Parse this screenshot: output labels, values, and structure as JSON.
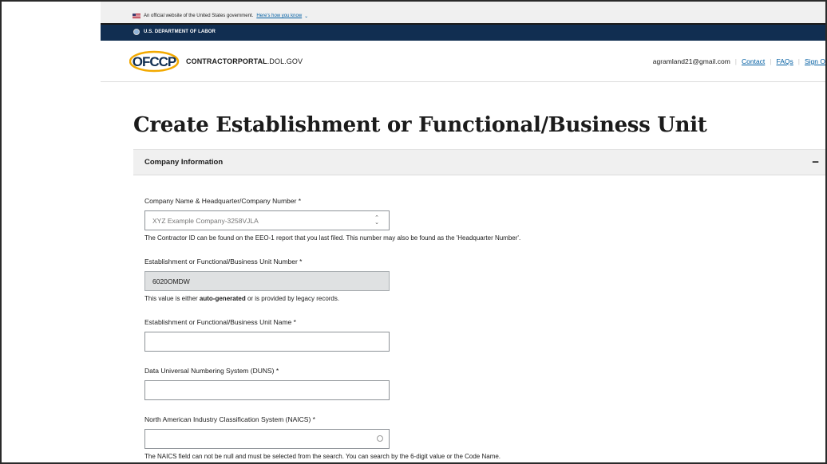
{
  "gov_banner": {
    "text": "An official website of the United States government.",
    "link": "Here's how you know"
  },
  "agency_bar": {
    "name": "U.S. DEPARTMENT OF LABOR"
  },
  "header": {
    "logo_text": "OFCCP",
    "portal_name_bold": "CONTRACTORPORTAL",
    "portal_name_rest": ".DOL.GOV",
    "user_email": "agramland21@gmail.com",
    "nav": {
      "contact": "Contact",
      "faqs": "FAQs",
      "sign_out": "Sign O"
    }
  },
  "page": {
    "title": "Create Establishment or Functional/Business Unit"
  },
  "accordion": {
    "title": "Company Information",
    "toggle": "−"
  },
  "form": {
    "company": {
      "label": "Company Name & Headquarter/Company Number *",
      "value": "XYZ Example Company-3258VJLA",
      "hint": "The Contractor ID can be found on the EEO-1 report that you last filed. This number may also be found as the 'Headquarter Number'."
    },
    "unit_number": {
      "label": "Establishment or Functional/Business Unit Number *",
      "value": "6020OMDW",
      "hint_pre": "This value is either ",
      "hint_bold": "auto-generated",
      "hint_post": " or is provided by legacy records."
    },
    "unit_name": {
      "label": "Establishment or Functional/Business Unit Name *",
      "value": ""
    },
    "duns": {
      "label": "Data Universal Numbering System (DUNS) *",
      "value": ""
    },
    "naics": {
      "label": "North American Industry Classification System (NAICS) *",
      "value": "",
      "hint": "The NAICS field can not be null and must be selected from the search. You can search by the 6-digit value or the Code Name."
    }
  }
}
